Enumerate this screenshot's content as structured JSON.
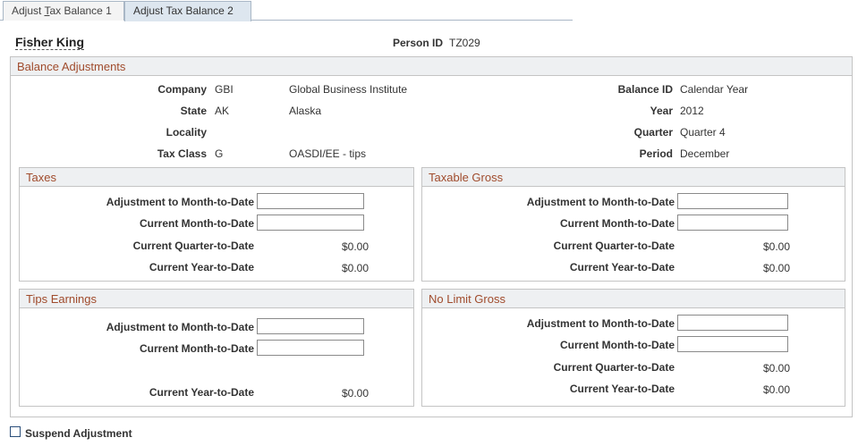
{
  "tabs": [
    {
      "label_pre": "Adjust ",
      "label_key": "T",
      "label_post": "ax Balance 1",
      "active": false
    },
    {
      "label": "Adjust Tax Balance 2",
      "active": true
    }
  ],
  "person": {
    "name": "Fisher King",
    "id_label": "Person ID",
    "id_value": "TZ029"
  },
  "balance": {
    "title": "Balance Adjustments",
    "company": {
      "label": "Company",
      "code": "GBI",
      "desc": "Global Business Institute"
    },
    "state": {
      "label": "State",
      "code": "AK",
      "desc": "Alaska"
    },
    "locality": {
      "label": "Locality"
    },
    "tax_class": {
      "label": "Tax Class",
      "code": "G",
      "desc": "OASDI/EE - tips"
    },
    "balance_id": {
      "label": "Balance ID",
      "value": "Calendar Year"
    },
    "year": {
      "label": "Year",
      "value": "2012"
    },
    "quarter": {
      "label": "Quarter",
      "value": "Quarter 4"
    },
    "period": {
      "label": "Period",
      "value": "December"
    }
  },
  "taxes": {
    "title": "Taxes",
    "adj_mtd": {
      "label": "Adjustment to Month-to-Date",
      "value": ""
    },
    "cur_mtd": {
      "label": "Current Month-to-Date",
      "value": ""
    },
    "cur_qtd": {
      "label": "Current Quarter-to-Date",
      "value": "$0.00"
    },
    "cur_ytd": {
      "label": "Current Year-to-Date",
      "value": "$0.00"
    }
  },
  "taxable": {
    "title": "Taxable Gross",
    "adj_mtd": {
      "label": "Adjustment to Month-to-Date",
      "value": ""
    },
    "cur_mtd": {
      "label": "Current Month-to-Date",
      "value": ""
    },
    "cur_qtd": {
      "label": "Current Quarter-to-Date",
      "value": "$0.00"
    },
    "cur_ytd": {
      "label": "Current Year-to-Date",
      "value": "$0.00"
    }
  },
  "tips": {
    "title": "Tips Earnings",
    "adj_mtd": {
      "label": "Adjustment to Month-to-Date",
      "value": ""
    },
    "cur_mtd": {
      "label": "Current Month-to-Date",
      "value": ""
    },
    "cur_ytd": {
      "label": "Current Year-to-Date",
      "value": "$0.00"
    }
  },
  "nolimit": {
    "title": "No Limit Gross",
    "adj_mtd": {
      "label": "Adjustment to Month-to-Date",
      "value": ""
    },
    "cur_mtd": {
      "label": "Current Month-to-Date",
      "value": ""
    },
    "cur_qtd": {
      "label": "Current Quarter-to-Date",
      "value": "$0.00"
    },
    "cur_ytd": {
      "label": "Current Year-to-Date",
      "value": "$0.00"
    }
  },
  "suspend": {
    "label": "Suspend Adjustment",
    "checked": false
  }
}
